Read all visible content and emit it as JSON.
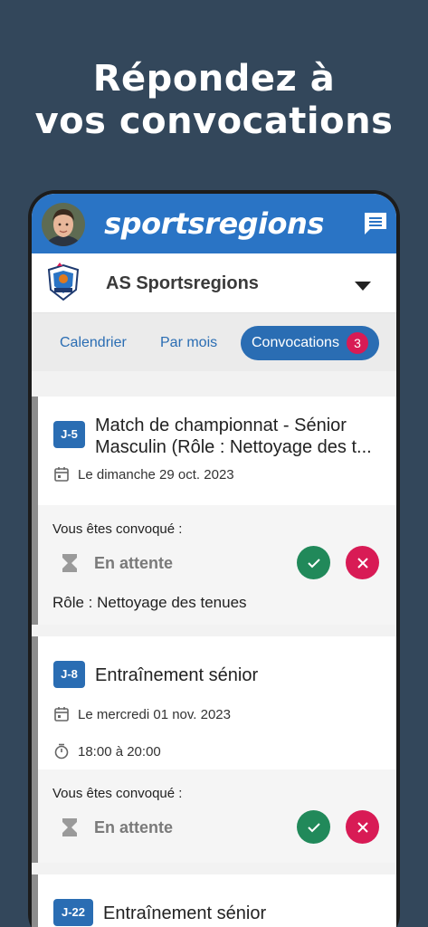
{
  "promo": {
    "line1": "Répondez à",
    "line2": "vos convocations"
  },
  "appbar": {
    "logo": "sportsregions",
    "avatar_icon": "user-avatar",
    "chat_icon": "chat-icon",
    "brand_color": "#2a74c5"
  },
  "club": {
    "name": "AS Sportsregions",
    "crest_icon": "club-crest-icon",
    "dropdown_icon": "caret-down-icon"
  },
  "tabs": {
    "calendrier": "Calendrier",
    "par_mois": "Par mois",
    "convocations": "Convocations",
    "convocations_count": "3",
    "active": "convocations"
  },
  "events": [
    {
      "tag": "J-5",
      "title_line1": "Match de championnat - Sénior",
      "title_line2": "Masculin (Rôle : Nettoyage des t...",
      "date": "Le dimanche 29 oct. 2023",
      "convoq_label": "Vous êtes convoqué :",
      "status": "En attente",
      "role": "Rôle : Nettoyage des tenues"
    },
    {
      "tag": "J-8",
      "title_line1": "Entraînement sénior",
      "date": "Le mercredi 01 nov. 2023",
      "time": "18:00 à 20:00",
      "convoq_label": "Vous êtes convoqué :",
      "status": "En attente"
    },
    {
      "tag": "J-22",
      "title_line1": "Entraînement sénior"
    }
  ],
  "colors": {
    "background": "#33475b",
    "accept": "#21895a",
    "decline": "#d81b55",
    "tag": "#2a6db3"
  }
}
